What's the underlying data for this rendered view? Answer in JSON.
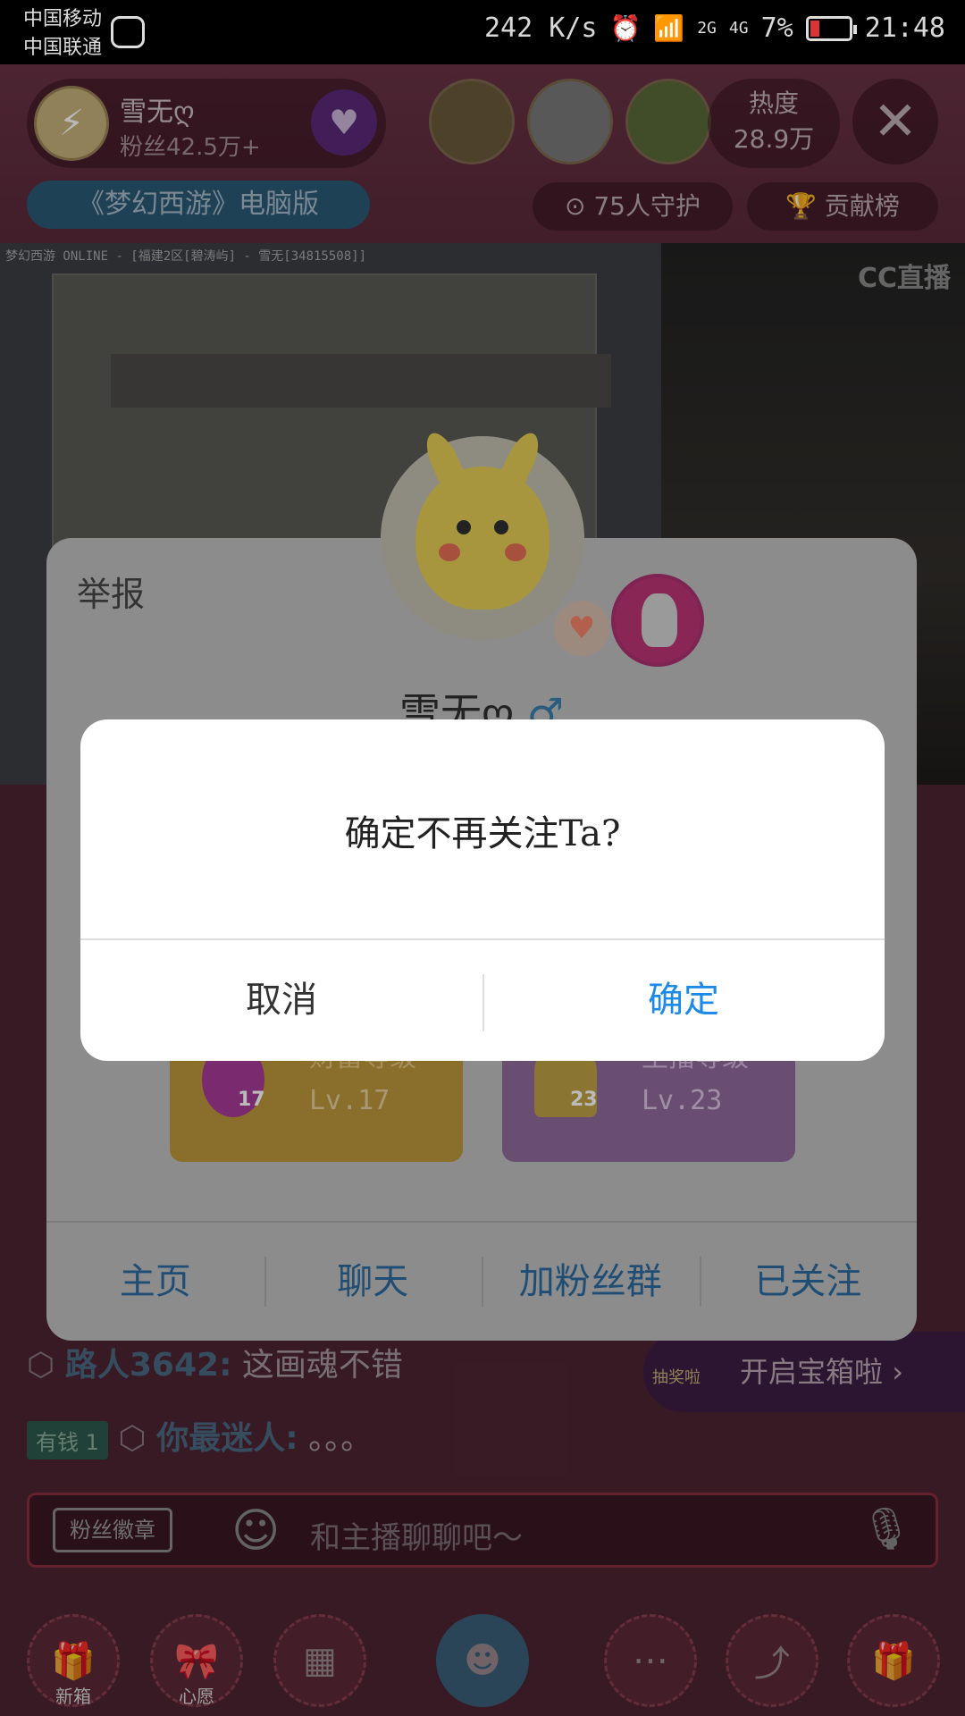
{
  "status_bar": {
    "carrier_1": "中国移动",
    "carrier_2": "中国联通",
    "net_speed": "242 K/s",
    "signal_1": "2G",
    "signal_2": "4G",
    "battery": "7%",
    "time": "21:48"
  },
  "room_header": {
    "anchor_name": "雪无ღ",
    "anchor_fans": "粉丝42.5万+",
    "heat_label": "热度",
    "heat_value": "28.9万",
    "game_title": "《梦幻西游》电脑版",
    "guard_count": "75人守护",
    "contribution_rank": "贡献榜"
  },
  "video": {
    "game_window_title": "梦幻西游 ONLINE - [福建2区[碧涛屿] - 雪无[34815508]]",
    "watermark": "CC直播"
  },
  "chat": {
    "messages": [
      {
        "nick": "路人3642:",
        "text": "这画魂不错"
      },
      {
        "tag": "有钱",
        "tag_level": "1",
        "nick": "你最迷人:",
        "text": "。。。"
      }
    ],
    "treasure_text": "开启宝箱啦",
    "treasure_caption": "抽奖啦",
    "fan_badge": "粉丝徽章",
    "input_placeholder": "和主播聊聊吧～"
  },
  "bottom_bar": {
    "new_box_caption": "新箱",
    "wish_caption": "心愿"
  },
  "profile_card": {
    "report": "举报",
    "name": "雪无ღ",
    "gender_symbol": "♂",
    "wealth_level_title": "财富等级",
    "wealth_level_value": "Lv.17",
    "wealth_badge_num": "17",
    "anchor_level_title": "主播等级",
    "anchor_level_value": "Lv.23",
    "anchor_badge_num": "23",
    "actions": [
      "主页",
      "聊天",
      "加粉丝群",
      "已关注"
    ]
  },
  "dialog": {
    "message": "确定不再关注Ta?",
    "cancel": "取消",
    "confirm": "确定"
  }
}
